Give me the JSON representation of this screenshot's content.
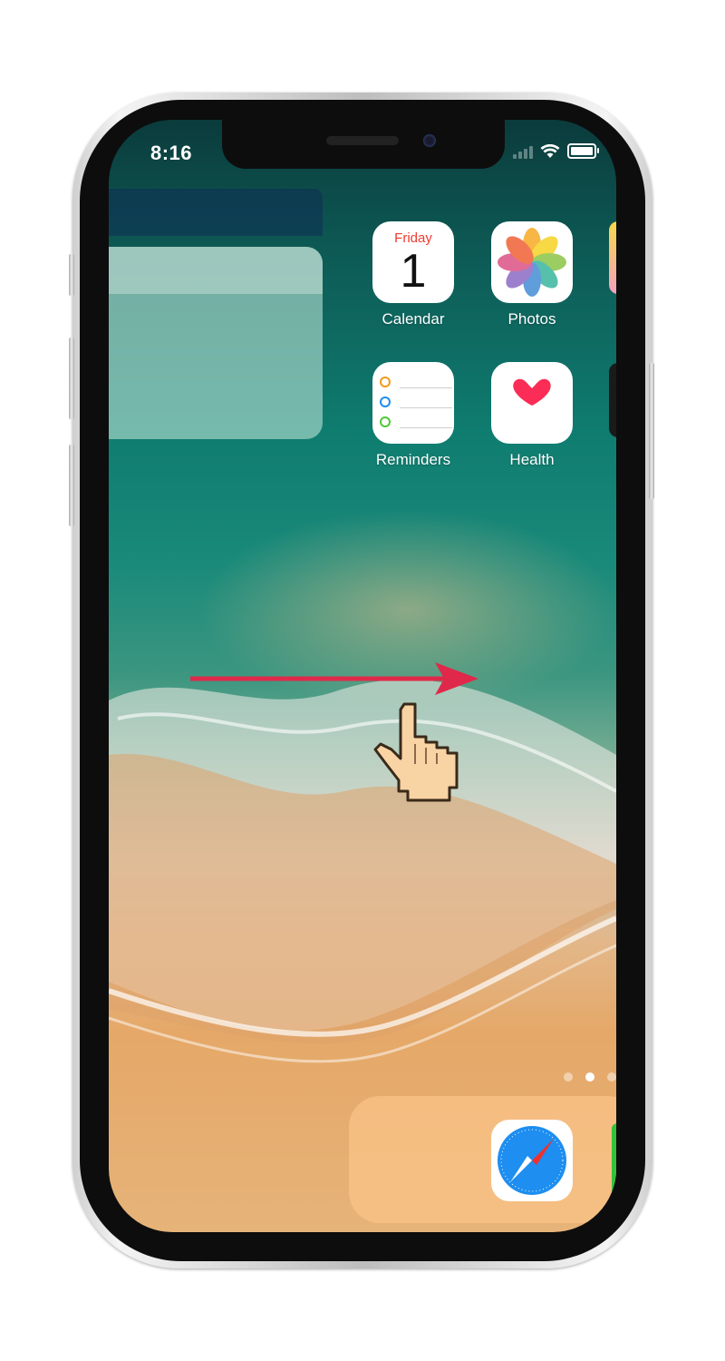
{
  "status_bar": {
    "time": "8:16",
    "signal_icon": "signal-bars-icon",
    "wifi_icon": "wifi-icon",
    "battery_icon": "battery-icon"
  },
  "apps": [
    {
      "name": "Calendar",
      "icon": "calendar-icon",
      "weekday": "Friday",
      "date": "1"
    },
    {
      "name": "Photos",
      "icon": "photos-icon"
    },
    {
      "name": "Reminders",
      "icon": "reminders-icon"
    },
    {
      "name": "Health",
      "icon": "health-icon"
    }
  ],
  "dock": {
    "apps": [
      {
        "name": "Safari",
        "icon": "safari-icon"
      }
    ]
  },
  "page_indicator": {
    "pages": 3,
    "current": 2
  },
  "overlay": {
    "gesture": "swipe-right",
    "arrow_color": "#e0294a",
    "cursor_icon": "hand-pointer-icon"
  }
}
